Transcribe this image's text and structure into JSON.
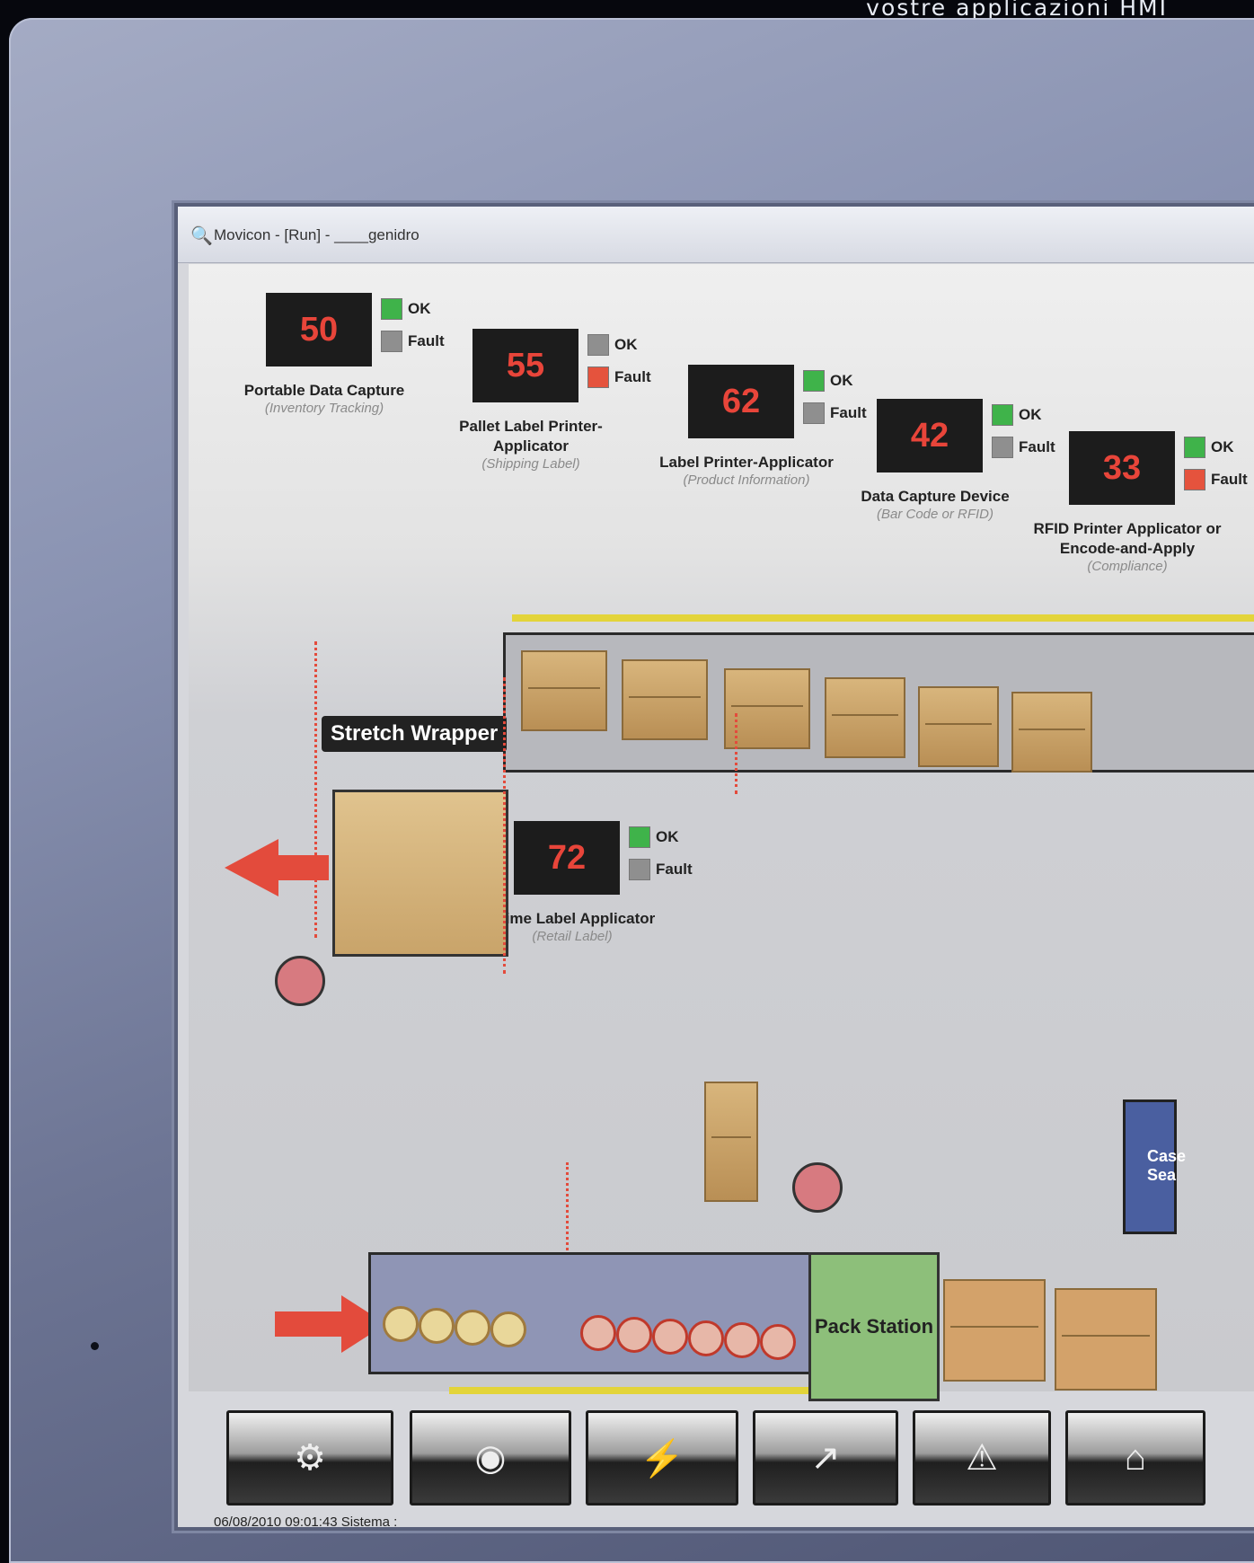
{
  "tagline": "vostre applicazioni HMI",
  "window": {
    "title": "Movicon - [Run] - ____genidro",
    "icon": "magnifier-icon"
  },
  "devices": [
    {
      "value": "50",
      "ok_label": "OK",
      "fault_label": "Fault",
      "ok_on": true,
      "fault_on": false,
      "name": "Portable Data Capture",
      "sub": "(Inventory Tracking)"
    },
    {
      "value": "55",
      "ok_label": "OK",
      "fault_label": "Fault",
      "ok_on": false,
      "fault_on": true,
      "name": "Pallet Label Printer-Applicator",
      "sub": "(Shipping Label)"
    },
    {
      "value": "62",
      "ok_label": "OK",
      "fault_label": "Fault",
      "ok_on": true,
      "fault_on": false,
      "name": "Label Printer-Applicator",
      "sub": "(Product Information)"
    },
    {
      "value": "42",
      "ok_label": "OK",
      "fault_label": "Fault",
      "ok_on": true,
      "fault_on": false,
      "name": "Data Capture Device",
      "sub": "(Bar Code or RFID)"
    },
    {
      "value": "33",
      "ok_label": "OK",
      "fault_label": "Fault",
      "ok_on": true,
      "fault_on": true,
      "name": "RFID Printer Applicator or Encode-and-Apply",
      "sub": "(Compliance)"
    },
    {
      "value": "72",
      "ok_label": "OK",
      "fault_label": "Fault",
      "ok_on": true,
      "fault_on": false,
      "name": "Prime Label Applicator",
      "sub": "(Retail Label)"
    }
  ],
  "stretch_wrapper_label": "Stretch Wrapper",
  "pack_station_label": "Pack Station",
  "case_sealer_label": "Case Sea",
  "toolbar": [
    {
      "icon": "gears-icon",
      "glyph": "⚙"
    },
    {
      "icon": "robot-icon",
      "glyph": "◉"
    },
    {
      "icon": "lightning-icon",
      "glyph": "⚡"
    },
    {
      "icon": "trend-chart-icon",
      "glyph": "↗"
    },
    {
      "icon": "warning-icon",
      "glyph": "⚠"
    },
    {
      "icon": "home-icon",
      "glyph": "⌂"
    }
  ],
  "status": {
    "text": "06/08/2010 09:01:43 Sistema :"
  },
  "colors": {
    "ok": "#3fb34a",
    "fault": "#e5533d",
    "inactive": "#8f8f8f",
    "value_text": "#e8453a"
  }
}
